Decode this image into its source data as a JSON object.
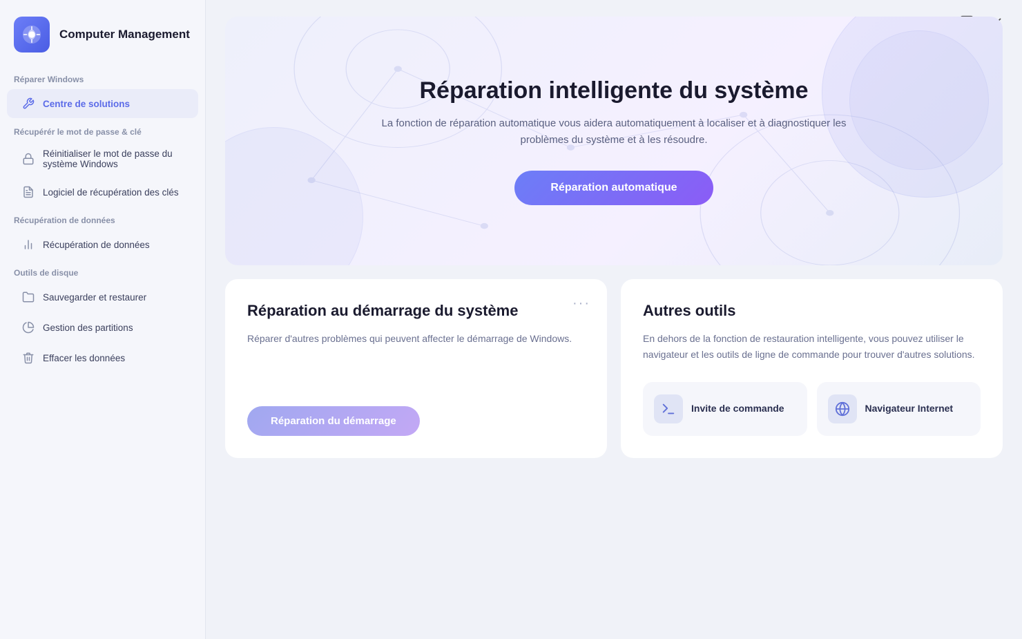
{
  "app": {
    "title": "Computer Management",
    "logo_alt": "app-logo"
  },
  "window_controls": {
    "chat_icon": "💬",
    "close_icon": "✕"
  },
  "sidebar": {
    "sections": [
      {
        "label": "Réparer Windows",
        "items": [
          {
            "id": "centre-de-solutions",
            "label": "Centre de solutions",
            "icon": "wrench",
            "active": true
          }
        ]
      },
      {
        "label": "Récupérér le mot de passe  & clé",
        "items": [
          {
            "id": "reinitialiser-mot-de-passe",
            "label": "Réinitialiser le mot de passe du système Windows",
            "icon": "lock",
            "active": false
          },
          {
            "id": "logiciel-recuperation-cles",
            "label": "Logiciel de récupération des clés",
            "icon": "file",
            "active": false
          }
        ]
      },
      {
        "label": "Récupération de données",
        "items": [
          {
            "id": "recuperation-de-donnees",
            "label": "Récupération de données",
            "icon": "chart",
            "active": false
          }
        ]
      },
      {
        "label": "Outils de disque",
        "items": [
          {
            "id": "sauvegarder-et-restaurer",
            "label": "Sauvegarder et restaurer",
            "icon": "folder",
            "active": false
          },
          {
            "id": "gestion-des-partitions",
            "label": "Gestion des partitions",
            "icon": "pie",
            "active": false
          },
          {
            "id": "effacer-les-donnees",
            "label": "Effacer les données",
            "icon": "trash",
            "active": false
          }
        ]
      }
    ]
  },
  "hero": {
    "title": "Réparation intelligente du système",
    "description": "La fonction de réparation automatique vous aidera automatiquement à localiser et à diagnostiquer les problèmes du système et à les résoudre.",
    "button_label": "Réparation automatique"
  },
  "card_startup": {
    "title": "Réparation au démarrage du système",
    "description": "Réparer d'autres problèmes qui peuvent affecter le démarrage de Windows.",
    "button_label": "Réparation du démarrage",
    "more": "···"
  },
  "card_tools": {
    "title": "Autres outils",
    "description": "En dehors de la fonction de restauration intelligente, vous pouvez utiliser le navigateur et les outils de ligne de commande pour trouver d'autres solutions.",
    "tools": [
      {
        "id": "invite-commande",
        "label": "Invite de commande",
        "icon": "terminal"
      },
      {
        "id": "navigateur-internet",
        "label": "Navigateur Internet",
        "icon": "globe"
      }
    ]
  }
}
